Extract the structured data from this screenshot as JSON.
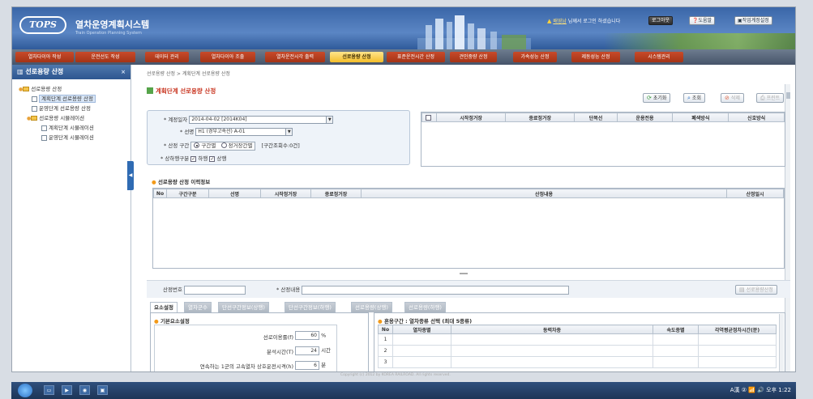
{
  "header": {
    "logo": "TOPS",
    "title": "열차운영계획시스템",
    "subtitle": "Train Operation Planning System",
    "user_name": "배영남",
    "welcome_text": "님께서 로그인 하셨습니다",
    "buttons": {
      "logout": "로그아웃",
      "help": "도움말",
      "plan_setup": "작업계정설정"
    }
  },
  "nav": {
    "items": [
      "열차다이아 작성",
      "운전선도 작성",
      "데이터 관리",
      "열차다이아 조출",
      "열차운전시각 출력",
      "선로용량 산정",
      "표준운전시간 산정",
      "견인중량 산정",
      "가속성능 산정",
      "제동성능 산정",
      "시스템관리"
    ],
    "active_index": 5
  },
  "sidebar": {
    "title": "선로용량 산정",
    "close": "×",
    "tree": [
      {
        "label": "선로용량 산정",
        "level": 1,
        "type": "folder"
      },
      {
        "label": "계획단계 선로용량 산정",
        "level": 2,
        "type": "doc",
        "selected": true
      },
      {
        "label": "운영단계 선로용량 산정",
        "level": 2,
        "type": "doc"
      },
      {
        "label": "선로용량 시뮬레이션",
        "level": 2,
        "type": "folder"
      },
      {
        "label": "계획단계 시뮬레이션",
        "level": 3,
        "type": "doc"
      },
      {
        "label": "운영단계 시뮬레이션",
        "level": 3,
        "type": "doc"
      }
    ]
  },
  "breadcrumb": "선로용량 산정 > 계획단계 선로용량 산정",
  "page_title": "계획단계 선로용량 산정",
  "toolbar": {
    "reset": "초기화",
    "search": "조회",
    "delete": "삭제",
    "print": "프린트"
  },
  "criteria": {
    "plan_date_label": "* 계정일자",
    "plan_date_value": "2014-04-02 [2014K04]",
    "line_label": "* 선명",
    "line_value": "H1 (경부고속선) A-01",
    "range_label": "* 산정 구간",
    "range_opt1": "구간별",
    "range_opt2": "정거장간별",
    "range_count": "[구간조회수:0건]",
    "direction_label": "* 상하행구분",
    "dir_down": "하행",
    "dir_up": "상행"
  },
  "direction_grid": {
    "columns": [
      "",
      "시작정거장",
      "종료정거장",
      "단복선",
      "운용전용",
      "폐색방식",
      "신호방식"
    ]
  },
  "history": {
    "title": "선로용량 산정 이력정보",
    "columns": [
      "No",
      "구간구분",
      "선명",
      "시작정거장",
      "종료정거장",
      "산정내용",
      "산정일시"
    ]
  },
  "calc_form": {
    "calc_no_label": "산정번호",
    "calc_content_label": "* 산정내용",
    "calc_button": "선로용량산정"
  },
  "tabs": [
    "요소설정",
    "열차군수",
    "단선구간정보(상행)",
    "단선구간정보(하행)",
    "선로용량(상행)",
    "선로용량(하행)"
  ],
  "basic_options": {
    "title": "기본요소설정",
    "rows": [
      {
        "label": "선로이용률(f)",
        "value": "60",
        "unit": "%"
      },
      {
        "label": "분석시간(T)",
        "value": "24",
        "unit": "시간"
      },
      {
        "label": "연속하는 1군의 고속열차 상호운전시격(h)",
        "value": "6",
        "unit": "분"
      }
    ]
  },
  "train_panel": {
    "title": "혼용구간 : 열차종류 선택 (최대 5종류)",
    "columns": [
      "No",
      "열차종별",
      "동력차종",
      "속도종별",
      "각역평균정차시간(분)"
    ],
    "rows": [
      "1",
      "2",
      "3"
    ]
  },
  "footer": {
    "copyright": "Copyright (c) 2012 by KOREA RAILROAD. All rights reserved."
  },
  "taskbar": {
    "clock": "오후 1:22",
    "tray": "A漢 ②"
  }
}
